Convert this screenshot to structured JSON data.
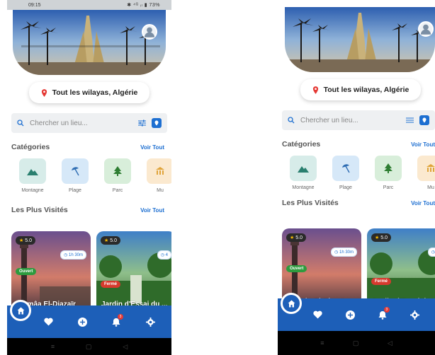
{
  "status_bar": {
    "time": "09:15",
    "icons": "✱ ⁴ᴳ ᵢₗ ▮ 73%"
  },
  "location": {
    "label": "Tout les wilayas, Algérie"
  },
  "search": {
    "placeholder": "Chercher un lieu..."
  },
  "categories": {
    "title": "Catégories",
    "see_all": "Voir Tout",
    "items": [
      {
        "label": "Montagne",
        "icon": "mountain-icon",
        "color": "#d7ece9"
      },
      {
        "label": "Plage",
        "icon": "umbrella-icon",
        "color": "#d6e8f8"
      },
      {
        "label": "Parc",
        "icon": "tree-icon",
        "color": "#d8eeda"
      },
      {
        "label": "Mu",
        "icon": "museum-icon",
        "color": "#fbe9cf"
      }
    ]
  },
  "popular": {
    "title": "Les Plus Visités",
    "see_all": "Voir Tout",
    "cards": [
      {
        "name": "Djamâa El-Djazaïr",
        "rating": "5.0",
        "duration": "1h 30m",
        "status": "Ouvert",
        "status_color": "#2e9b3e"
      },
      {
        "name": "Jardin d'Essai du ...",
        "rating": "5.0",
        "duration": "4",
        "status": "Fermé",
        "status_color": "#d73a2e"
      }
    ]
  },
  "nav": {
    "items": [
      "home-icon",
      "heart-icon",
      "add-icon",
      "notification-icon",
      "settings-icon"
    ],
    "badge": "3"
  },
  "colors": {
    "primary": "#1d5fb8",
    "accent": "#1d6fd1",
    "pin": "#e53935"
  }
}
